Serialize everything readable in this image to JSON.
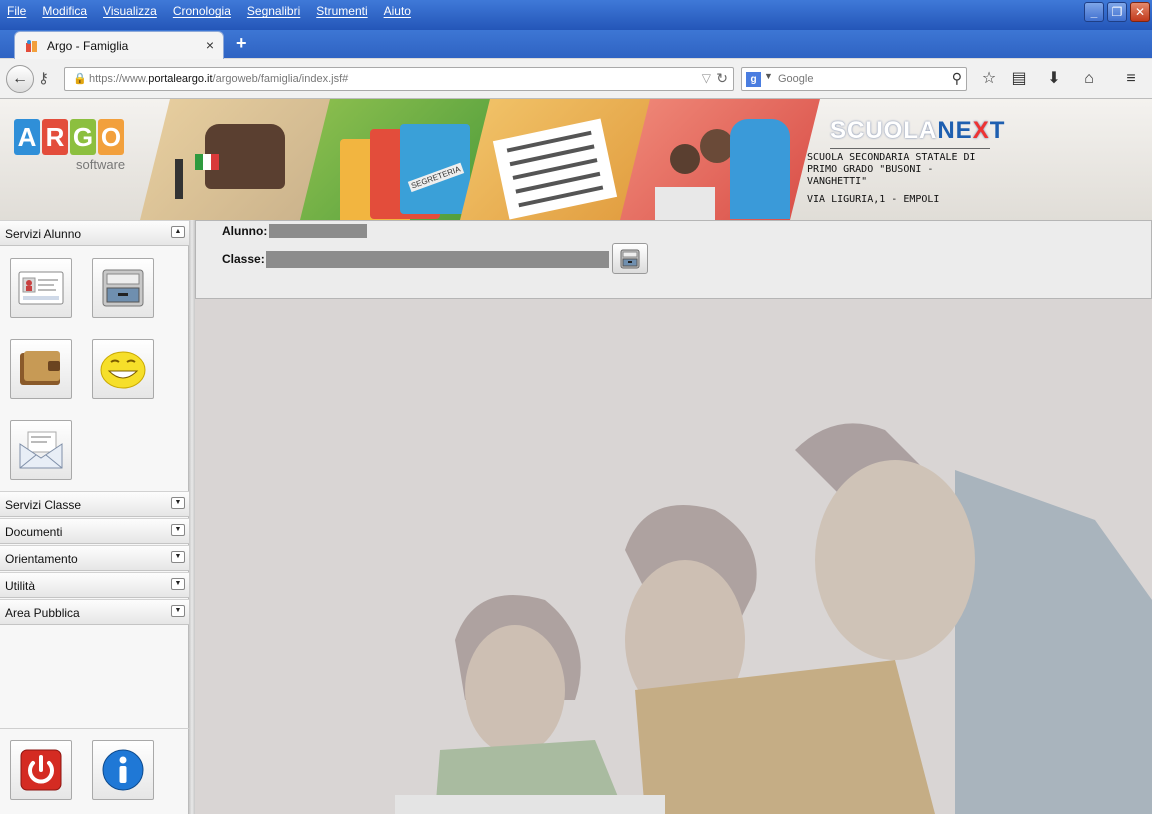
{
  "browser": {
    "menu": [
      "File",
      "Modifica",
      "Visualizza",
      "Cronologia",
      "Segnalibri",
      "Strumenti",
      "Aiuto"
    ],
    "window_controls": {
      "minimize": "minimize-icon",
      "restore": "restore-icon",
      "close": "close-icon"
    },
    "tab": {
      "title": "Argo - Famiglia",
      "close": "×"
    },
    "new_tab": "+",
    "url": {
      "prefix": "https://www.",
      "domain": "portaleargo.it",
      "path": "/argoweb/famiglia/index.jsf#"
    },
    "search": {
      "engine_badge": "g",
      "placeholder": "Google"
    }
  },
  "header": {
    "logo_letters": [
      "A",
      "R",
      "G",
      "O"
    ],
    "logo_colors": [
      "#2f8fd8",
      "#e34d3b",
      "#8cbf3f",
      "#f2a03c"
    ],
    "logo_sub": "software",
    "brand_a": "SCUOLA",
    "brand_b": "NE",
    "brand_c": "X",
    "brand_d": "T",
    "school": "SCUOLA SECONDARIA STATALE DI\nPRIMO GRADO \"BUSONI -\nVANGHETTI\"",
    "address": "VIA LIGURIA,1 - EMPOLI",
    "folder_label": "SEGRETERIA"
  },
  "sidebar": {
    "sections": [
      {
        "label": "Servizi Alunno",
        "toggle": "▲"
      },
      {
        "label": "Servizi Classe",
        "toggle": "▼"
      },
      {
        "label": "Documenti",
        "toggle": "▼"
      },
      {
        "label": "Orientamento",
        "toggle": "▼"
      },
      {
        "label": "Utilità",
        "toggle": "▼"
      },
      {
        "label": "Area Pubblica",
        "toggle": "▼"
      }
    ],
    "tiles": [
      "student-card-icon",
      "cabinet-icon",
      "wallet-icon",
      "smiley-icon",
      "envelope-icon"
    ],
    "bottom_buttons": [
      "power-icon",
      "info-icon"
    ]
  },
  "main": {
    "alunno_label": "Alunno:",
    "classe_label": "Classe:"
  }
}
